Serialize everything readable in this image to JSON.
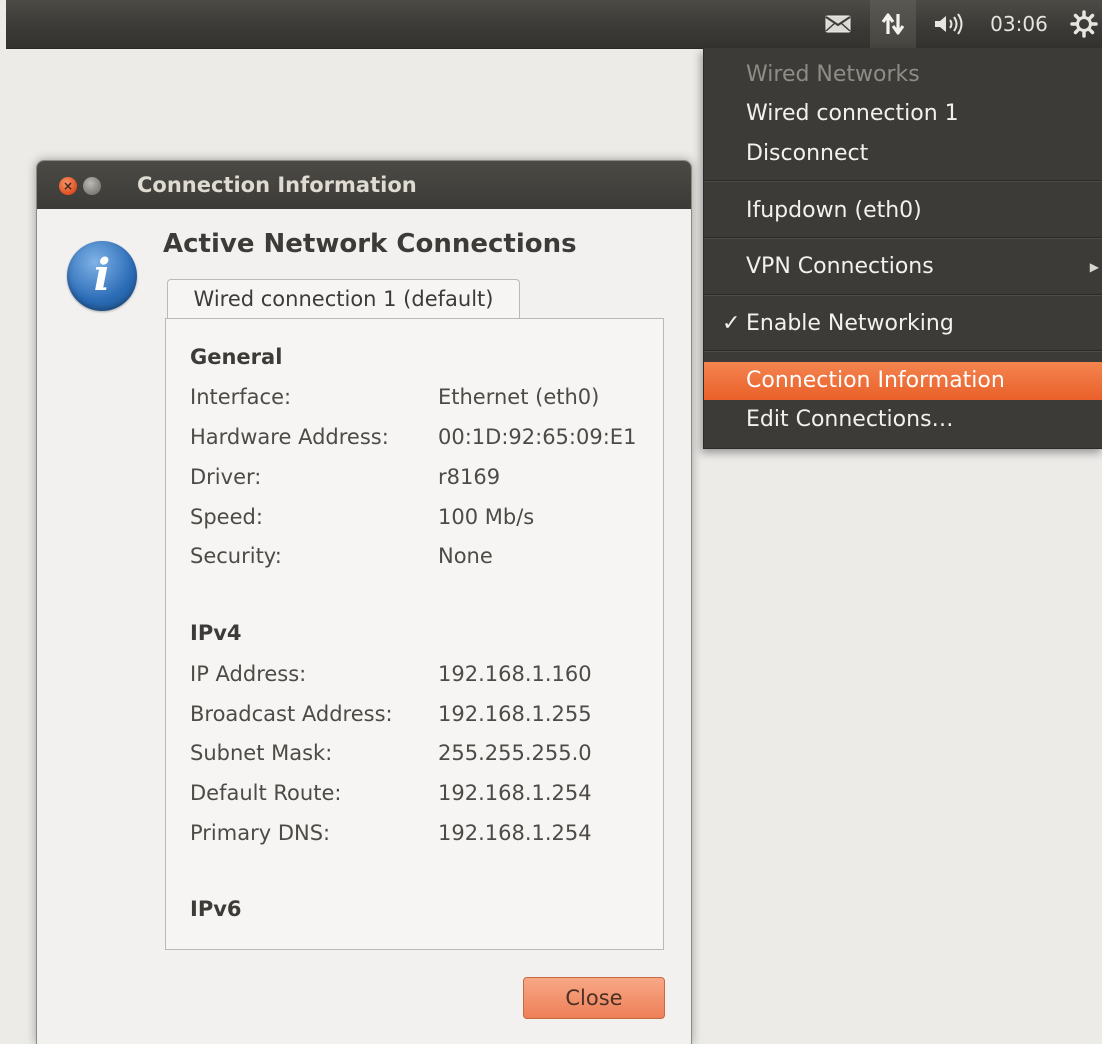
{
  "panel": {
    "clock": "03:06",
    "icons": [
      "mail-icon",
      "network-icon",
      "volume-icon",
      "session-gear-icon"
    ]
  },
  "menu": {
    "wired_header": "Wired Networks",
    "wired_connection": "Wired connection 1",
    "disconnect": "Disconnect",
    "ifupdown": "Ifupdown (eth0)",
    "vpn": "VPN Connections",
    "enable_networking": "Enable Networking",
    "connection_info": "Connection Information",
    "edit_connections": "Edit Connections…"
  },
  "dialog": {
    "title": "Connection Information",
    "heading": "Active Network Connections",
    "tab_label": "Wired connection 1 (default)",
    "close_label": "Close",
    "general": {
      "header": "General",
      "rows": [
        {
          "label": "Interface:",
          "value": "Ethernet (eth0)"
        },
        {
          "label": "Hardware Address:",
          "value": "00:1D:92:65:09:E1"
        },
        {
          "label": "Driver:",
          "value": "r8169"
        },
        {
          "label": "Speed:",
          "value": "100 Mb/s"
        },
        {
          "label": "Security:",
          "value": "None"
        }
      ]
    },
    "ipv4": {
      "header": "IPv4",
      "rows": [
        {
          "label": "IP Address:",
          "value": "192.168.1.160"
        },
        {
          "label": "Broadcast Address:",
          "value": "192.168.1.255"
        },
        {
          "label": "Subnet Mask:",
          "value": "255.255.255.0"
        },
        {
          "label": "Default Route:",
          "value": "192.168.1.254"
        },
        {
          "label": "Primary DNS:",
          "value": "192.168.1.254"
        }
      ]
    },
    "ipv6": {
      "header": "IPv6"
    }
  },
  "colors": {
    "panel": "#3c3b37",
    "menu_highlight": "#f07746",
    "close_button": "#f29070",
    "info_icon": "#2b6cb7"
  }
}
